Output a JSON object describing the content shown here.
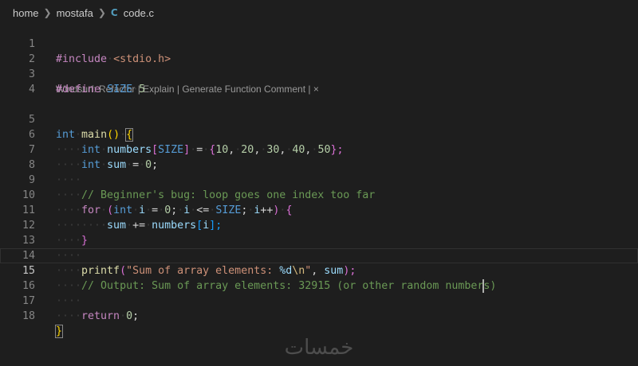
{
  "breadcrumb": {
    "items": [
      "home",
      "mostafa"
    ],
    "file_icon": "C",
    "file": "code.c"
  },
  "codelens": {
    "prefix": "Windsurf: ",
    "refactor": "Refactor",
    "explain": "Explain",
    "generate": "Generate Function Comment",
    "sep": " | ",
    "close": "×"
  },
  "line_numbers": [
    "1",
    "2",
    "3",
    "4",
    "5",
    "6",
    "7",
    "8",
    "9",
    "10",
    "11",
    "12",
    "13",
    "14",
    "15",
    "16",
    "17",
    "18"
  ],
  "code": {
    "l1": [
      "#include",
      "<stdio.h>"
    ],
    "l3": [
      "#define",
      "SIZE",
      "5"
    ],
    "l5": [
      "int",
      "main",
      "()",
      "{"
    ],
    "l6": [
      "int",
      "numbers",
      "[",
      "SIZE",
      "]",
      "=",
      "{",
      "10",
      "20",
      "30",
      "40",
      "50",
      "};"
    ],
    "l7": [
      "int",
      "sum",
      "=",
      "0",
      ";"
    ],
    "l9": "// Beginner's bug: loop goes one index too far",
    "l10": [
      "for",
      "(",
      "int",
      "i",
      "=",
      "0",
      ";",
      "i",
      "<=",
      "SIZE",
      ";",
      "i",
      "++",
      ")",
      "{"
    ],
    "l11": [
      "sum",
      "+=",
      "numbers",
      "[",
      "i",
      "];"
    ],
    "l12": "}",
    "l14": [
      "printf",
      "(",
      "\"Sum of array elements: ",
      "%d",
      "\\n",
      "\"",
      ", ",
      "sum",
      ");"
    ],
    "l15a": "// Output: Sum of array elements: 32915 (or other random number",
    "l15b": "s)",
    "l17": [
      "return",
      "0",
      ";"
    ],
    "l18": "}"
  },
  "watermark": "خمسات"
}
